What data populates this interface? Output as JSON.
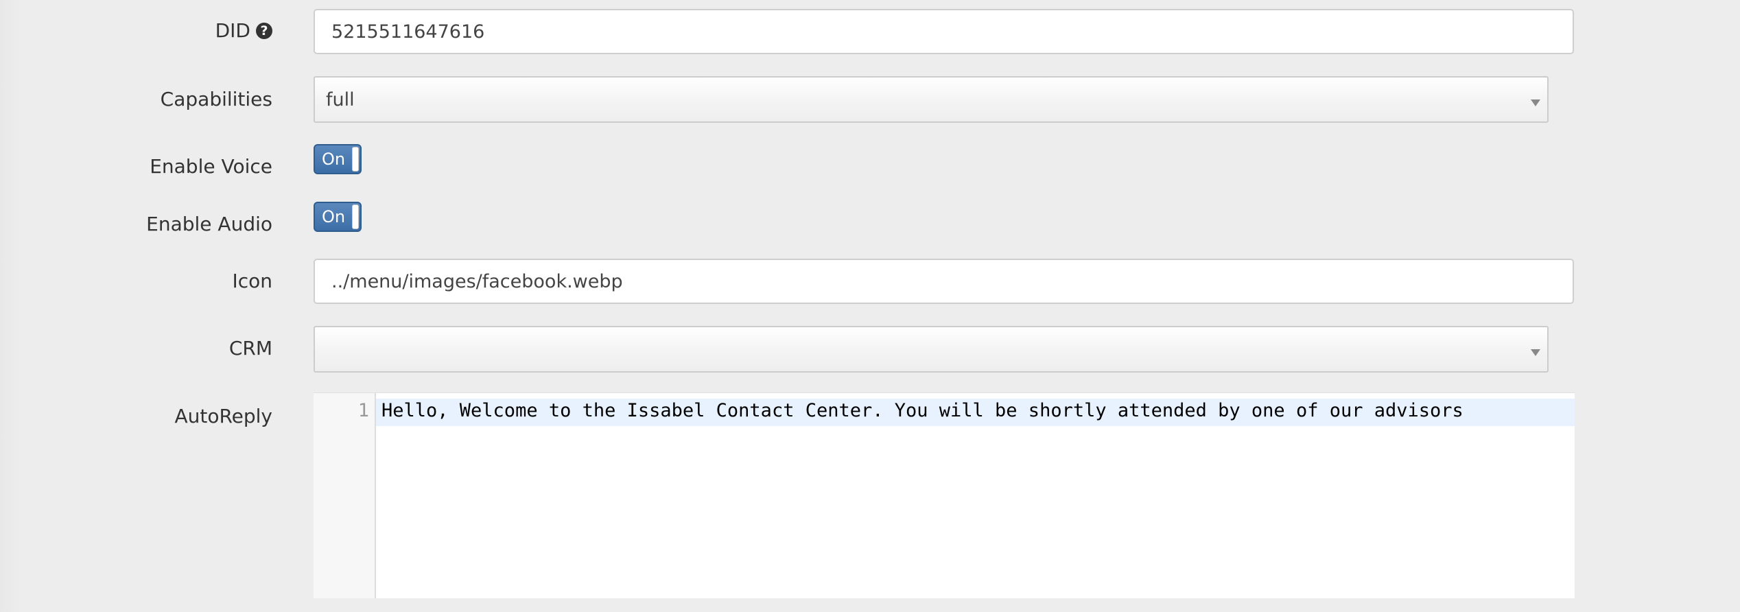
{
  "form": {
    "did": {
      "label": "DID",
      "help_icon": "question-circle-icon",
      "value": "5215511647616"
    },
    "capabilities": {
      "label": "Capabilities",
      "selected": "full"
    },
    "enable_voice": {
      "label": "Enable Voice",
      "state": "On"
    },
    "enable_audio": {
      "label": "Enable Audio",
      "state": "On"
    },
    "icon": {
      "label": "Icon",
      "value": "../menu/images/facebook.webp"
    },
    "crm": {
      "label": "CRM",
      "selected": ""
    },
    "autoreply": {
      "label": "AutoReply",
      "lines": [
        {
          "number": "1",
          "text": "Hello, Welcome to the Issabel Contact Center. You will be shortly attended by one of our advisors"
        }
      ]
    }
  },
  "colors": {
    "toggle_on": "#3c6ea6",
    "active_line": "#e8f2ff",
    "background": "#ededed"
  }
}
